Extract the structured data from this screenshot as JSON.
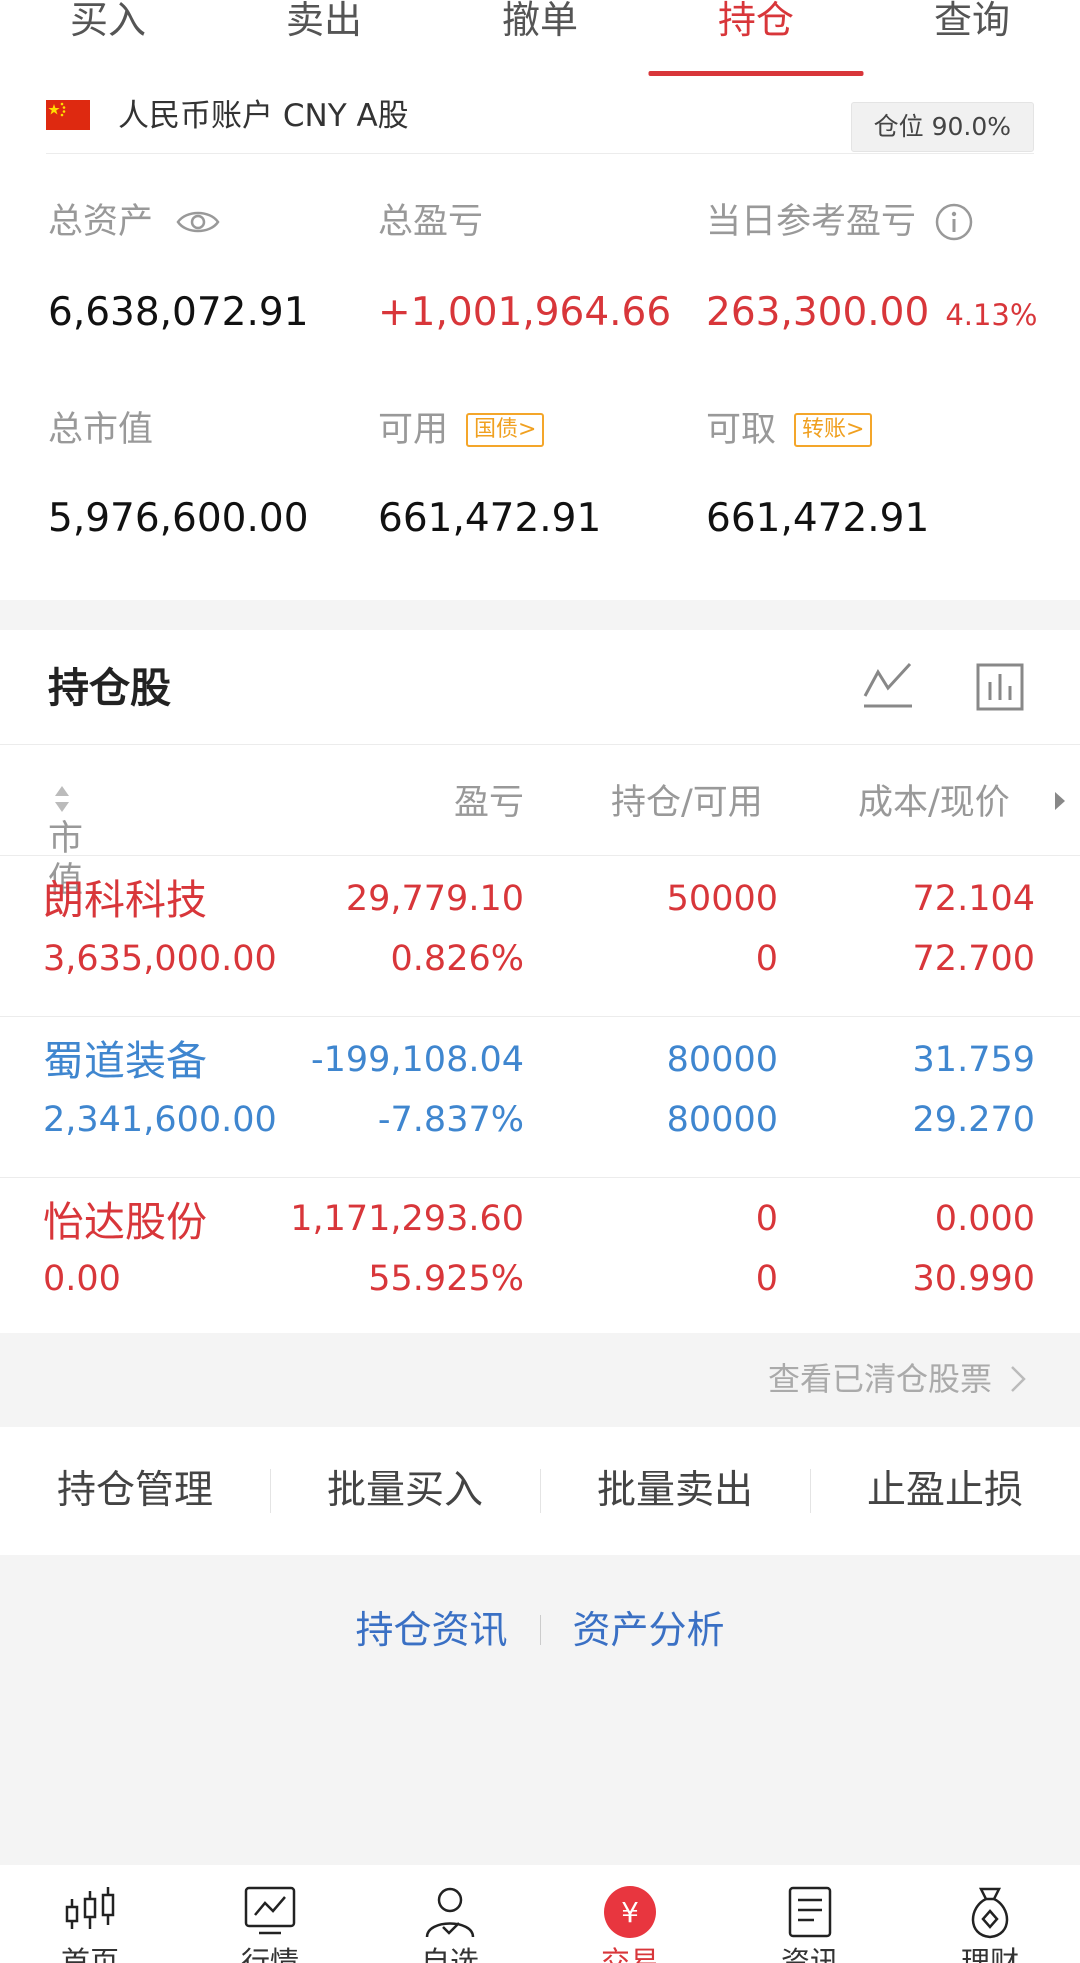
{
  "tabs": [
    {
      "label": "买入"
    },
    {
      "label": "卖出"
    },
    {
      "label": "撤单"
    },
    {
      "label": "持仓",
      "active": true
    },
    {
      "label": "查询"
    }
  ],
  "account": {
    "name": "人民币账户 CNY A股",
    "position_label": "仓位 90.0%"
  },
  "summary": {
    "total_assets_label": "总资产",
    "total_assets": "6,638,072.91",
    "total_pnl_label": "总盈亏",
    "total_pnl": "+1,001,964.66",
    "daily_pnl_label": "当日参考盈亏",
    "daily_pnl": "263,300.00",
    "daily_pnl_pct": "4.13%",
    "market_value_label": "总市值",
    "market_value": "5,976,600.00",
    "available_label": "可用",
    "available_tag": "国债>",
    "available": "661,472.91",
    "withdrawable_label": "可取",
    "withdrawable_tag": "转账>",
    "withdrawable": "661,472.91"
  },
  "holdings": {
    "title": "持仓股",
    "columns": {
      "market_value": "市值",
      "pnl": "盈亏",
      "position": "持仓/可用",
      "cost_price": "成本/现价"
    },
    "rows": [
      {
        "name": "朗科科技",
        "market_value": "3,635,000.00",
        "pnl": "29,779.10",
        "pnl_pct": "0.826%",
        "position": "50000",
        "available": "0",
        "cost": "72.104",
        "price": "72.700",
        "color": "#d8363a"
      },
      {
        "name": "蜀道装备",
        "market_value": "2,341,600.00",
        "pnl": "-199,108.04",
        "pnl_pct": "-7.837%",
        "position": "80000",
        "available": "80000",
        "cost": "31.759",
        "price": "29.270",
        "color": "#3f86cf"
      },
      {
        "name": "怡达股份",
        "market_value": "0.00",
        "pnl": "1,171,293.60",
        "pnl_pct": "55.925%",
        "position": "0",
        "available": "0",
        "cost": "0.000",
        "price": "30.990",
        "color": "#d8363a"
      }
    ],
    "cleared_link": "查看已清仓股票"
  },
  "actions": [
    {
      "label": "持仓管理"
    },
    {
      "label": "批量买入"
    },
    {
      "label": "批量卖出"
    },
    {
      "label": "止盈止损"
    }
  ],
  "links": {
    "news": "持仓资讯",
    "analysis": "资产分析"
  },
  "bottom_nav": [
    {
      "label": "首页",
      "icon": "candlestick-icon"
    },
    {
      "label": "行情",
      "icon": "chart-icon"
    },
    {
      "label": "自选",
      "icon": "person-check-icon"
    },
    {
      "label": "交易",
      "icon": "yuan-icon",
      "active": true
    },
    {
      "label": "资讯",
      "icon": "document-icon"
    },
    {
      "label": "理财",
      "icon": "money-bag-icon"
    }
  ],
  "colors": {
    "accent_red": "#d8363a",
    "loss_blue": "#3f86cf",
    "tag_orange": "#f0a020",
    "link_blue": "#3a70c4"
  }
}
